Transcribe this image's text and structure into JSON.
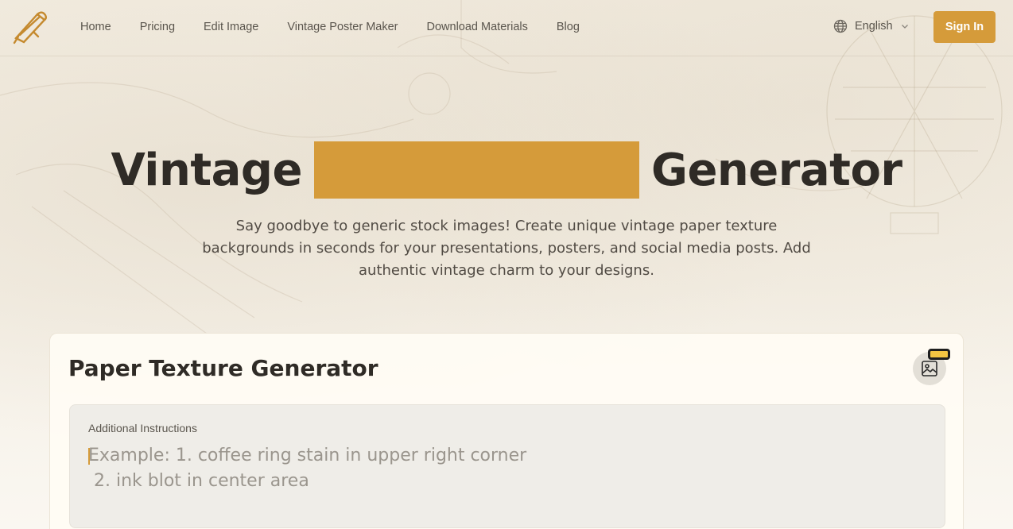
{
  "header": {
    "logo_icon": "pen-scroll-icon",
    "nav": [
      "Home",
      "Pricing",
      "Edit Image",
      "Vintage Poster Maker",
      "Download Materials",
      "Blog"
    ],
    "language": "English",
    "signin_label": "Sign In"
  },
  "hero": {
    "title_before": "Vintage",
    "title_after": "Generator",
    "highlight_color": "#d59b3a",
    "subtitle": "Say goodbye to generic stock images! Create unique vintage paper texture backgrounds in seconds for your presentations, posters, and social media posts. Add authentic vintage charm to your designs."
  },
  "generator": {
    "title": "Paper Texture Generator",
    "image_button_icon": "image-icon",
    "instructions_label": "Additional Instructions",
    "instructions_placeholder": "Example: 1. coffee ring stain in upper right corner\n 2. ink blot in center area",
    "instructions_value": ""
  },
  "colors": {
    "accent": "#d59b3a",
    "text": "#2f2b26",
    "background": "#f6f1e6"
  }
}
